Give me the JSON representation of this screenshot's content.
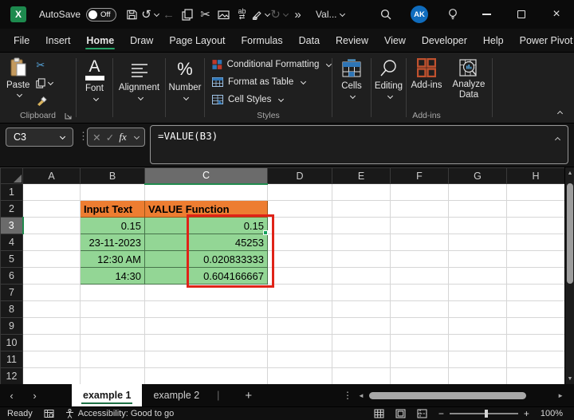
{
  "colors": {
    "excel_green": "#1d8a4e",
    "accent_underline": "#27a468",
    "selection_header_grey": "#6b6b6b",
    "table_header_orange": "#ED7D31",
    "table_body_green": "#93D695",
    "annotation_red": "#DF2318",
    "avatar_blue": "#0F6CBD",
    "share_button_green": "#1F7A48"
  },
  "icons": {
    "cut": "✂",
    "undo": "↺",
    "redo": "↻",
    "back": "←",
    "translate_ab": "ab",
    "translate_arrows": "⇄",
    "more": "»",
    "dots_vertical": "⋮",
    "close": "×",
    "check": "✓",
    "cancel": "✕",
    "nav_left": "‹",
    "nav_right": "›",
    "scroll_left": "◄",
    "scroll_right": "►",
    "scroll_up": "▲",
    "scroll_down": "▼",
    "minus": "−",
    "plus": "+"
  },
  "titlebar": {
    "app_icon_letter": "X",
    "autosave_label": "AutoSave",
    "autosave_state": "Off",
    "doc_title": "Val...",
    "avatar_initials": "AK"
  },
  "menubar": {
    "tabs": [
      "File",
      "Insert",
      "Home",
      "Draw",
      "Page Layout",
      "Formulas",
      "Data",
      "Review",
      "View",
      "Developer",
      "Help",
      "Power Pivot"
    ],
    "active_tab": "Home"
  },
  "ribbon": {
    "paste": "Paste",
    "clipboard_group": "Clipboard",
    "font": "Font",
    "font_glyph": "A",
    "alignment": "Alignment",
    "number": "Number",
    "number_glyph": "%",
    "conditional_formatting": "Conditional Formatting",
    "format_as_table": "Format as Table",
    "cell_styles": "Cell Styles",
    "styles_group": "Styles",
    "cells": "Cells",
    "editing": "Editing",
    "addins": "Add-ins",
    "analyze_line1": "Analyze",
    "analyze_line2": "Data",
    "addins_group": "Add-ins"
  },
  "formula_bar": {
    "name_box": "C3",
    "fx_label": "fx",
    "formula": "=VALUE(B3)"
  },
  "grid": {
    "column_headers": [
      "A",
      "B",
      "C",
      "D",
      "E",
      "F",
      "G",
      "H"
    ],
    "row_headers": [
      "1",
      "2",
      "3",
      "4",
      "5",
      "6",
      "7",
      "8",
      "9",
      "10",
      "11",
      "12"
    ],
    "selected_column": "C",
    "selected_row": "3",
    "cells": [
      {
        "ref": "B2",
        "text": "Input Text",
        "type": "header"
      },
      {
        "ref": "C2",
        "text": "VALUE Function",
        "type": "header"
      },
      {
        "ref": "B3",
        "text": "0.15",
        "type": "value"
      },
      {
        "ref": "C3",
        "text": "0.15",
        "type": "value"
      },
      {
        "ref": "B4",
        "text": "23-11-2023",
        "type": "value"
      },
      {
        "ref": "C4",
        "text": "45253",
        "type": "value"
      },
      {
        "ref": "B5",
        "text": "12:30 AM",
        "type": "value"
      },
      {
        "ref": "C5",
        "text": "0.020833333",
        "type": "value"
      },
      {
        "ref": "B6",
        "text": "14:30",
        "type": "value"
      },
      {
        "ref": "C6",
        "text": "0.604166667",
        "type": "value"
      }
    ],
    "annotation_range": "C3:C6"
  },
  "sheet_tabs": {
    "tabs": [
      {
        "label": "example 1",
        "active": true
      },
      {
        "label": "example 2",
        "active": false
      }
    ],
    "add_label": "+"
  },
  "status_bar": {
    "mode": "Ready",
    "accessibility": "Accessibility: Good to go",
    "zoom": "100%"
  }
}
